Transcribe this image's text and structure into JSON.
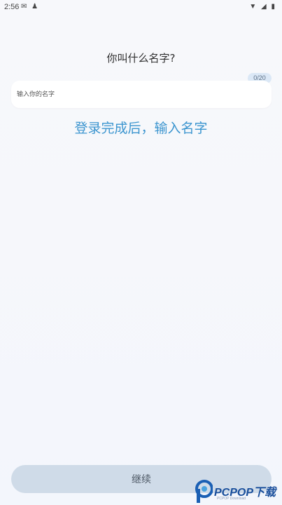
{
  "status_bar": {
    "time": "2:56",
    "left_icons": [
      "mail-icon",
      "notification-icon"
    ],
    "right_icons": [
      "wifi-icon",
      "signal-icon",
      "battery-icon"
    ]
  },
  "page": {
    "title": "你叫什么名字?"
  },
  "name_input": {
    "placeholder": "输入你的名字",
    "value": "",
    "counter": "0/20"
  },
  "overlay_hint": {
    "text": "登录完成后，输入名字",
    "color": "#3b95cf"
  },
  "continue_button": {
    "label": "继续",
    "background": "#cfdbe8"
  },
  "watermark": {
    "brand": "PCPOP下载",
    "subtitle": "PCPOP Download"
  }
}
